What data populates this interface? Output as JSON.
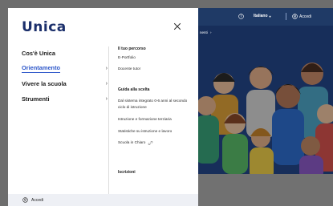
{
  "drawer": {
    "logo": "Unica",
    "left_menu": [
      {
        "label": "Cos'è Unica",
        "chevron": false,
        "active": false
      },
      {
        "label": "Orientamento",
        "chevron": true,
        "active": true
      },
      {
        "label": "Vivere la scuola",
        "chevron": true,
        "active": false
      },
      {
        "label": "Strumenti",
        "chevron": true,
        "active": false
      }
    ],
    "sections": {
      "percorso_title": "Il tuo percorso",
      "percorso_links": [
        "E-Portfolio",
        "Docente tutor"
      ],
      "guida_title": "Guida alla scelta",
      "guida_links": [
        "Dal sistema integrato 0-6 anni al secondo ciclo di istruzione",
        "Istruzione e formazione terziaria",
        "Statistiche su istruzione e lavoro",
        "Scuola in Chiaro"
      ],
      "iscrizioni_title": "Iscrizioni"
    },
    "footer_label": "Accedi"
  },
  "background": {
    "language": "Italiano",
    "login": "Accedi",
    "breadcrumb": "nenti"
  },
  "colors": {
    "brand_navy": "#1b2f6b",
    "accent_blue": "#2c56c9",
    "overlay_gray": "#6d6d6d"
  }
}
